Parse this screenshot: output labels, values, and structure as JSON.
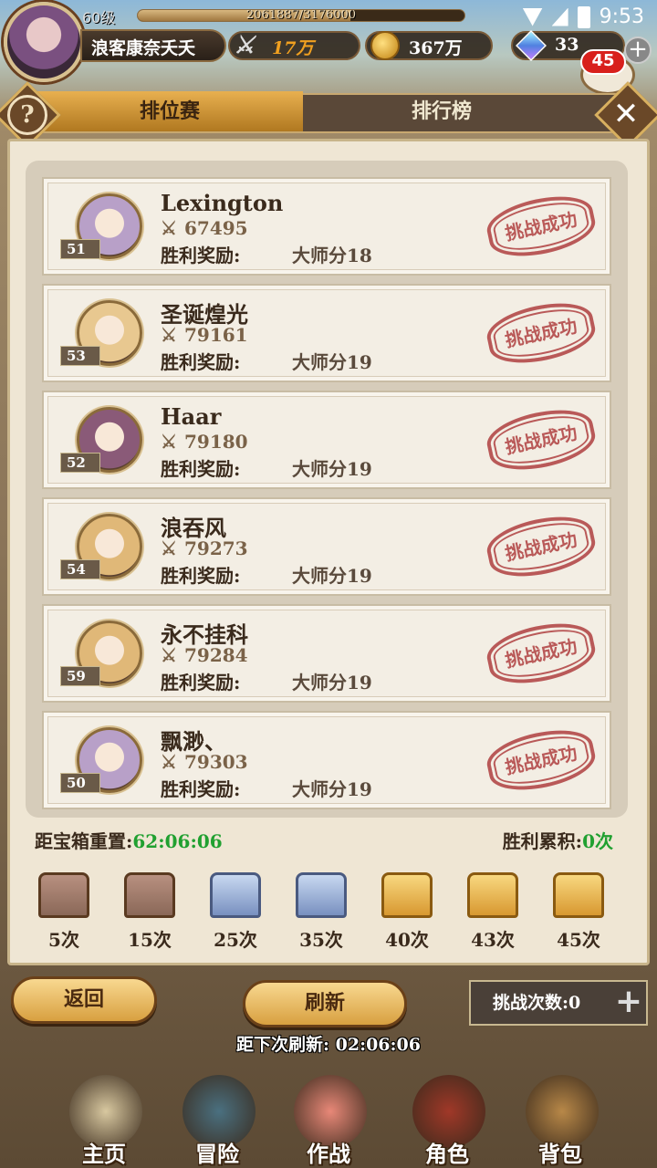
{
  "player": {
    "level": "60级",
    "exp": "2061887/3176000",
    "exp_fraction": 0.65,
    "name": "浪客康奈夭夭",
    "power": "17万",
    "gold": "367万",
    "gems": "33",
    "chat_badge": "45"
  },
  "status": {
    "time": "9:53"
  },
  "tabs": [
    {
      "label": "排位赛",
      "active": true
    },
    {
      "label": "排行榜",
      "active": false
    }
  ],
  "opponents": [
    {
      "name": "Lexington",
      "power": "67495",
      "level": "51",
      "reward_label": "胜利奖励:",
      "reward": "大师分18",
      "stamp": "挑战成功",
      "avatar_color": "#b8a0c8"
    },
    {
      "name": "圣诞煌光",
      "power": "79161",
      "level": "53",
      "reward_label": "胜利奖励:",
      "reward": "大师分19",
      "stamp": "挑战成功",
      "avatar_color": "#e8c890"
    },
    {
      "name": "Haar",
      "power": "79180",
      "level": "52",
      "reward_label": "胜利奖励:",
      "reward": "大师分19",
      "stamp": "挑战成功",
      "avatar_color": "#8a5a78"
    },
    {
      "name": "浪吞风",
      "power": "79273",
      "level": "54",
      "reward_label": "胜利奖励:",
      "reward": "大师分19",
      "stamp": "挑战成功",
      "avatar_color": "#e0b878"
    },
    {
      "name": "永不挂科",
      "power": "79284",
      "level": "59",
      "reward_label": "胜利奖励:",
      "reward": "大师分19",
      "stamp": "挑战成功",
      "avatar_color": "#e0b878"
    },
    {
      "name": "飘渺、",
      "power": "79303",
      "level": "50",
      "reward_label": "胜利奖励:",
      "reward": "大师分19",
      "stamp": "挑战成功",
      "avatar_color": "#b8a0c8"
    }
  ],
  "reset": {
    "label": "距宝箱重置:",
    "time": "62:06:06"
  },
  "wins": {
    "label": "胜利累积:",
    "value": "0次"
  },
  "chests": [
    {
      "label": "5次",
      "type": "wood"
    },
    {
      "label": "15次",
      "type": "wood"
    },
    {
      "label": "25次",
      "type": "silver"
    },
    {
      "label": "35次",
      "type": "silver"
    },
    {
      "label": "40次",
      "type": "gold"
    },
    {
      "label": "43次",
      "type": "gold"
    },
    {
      "label": "45次",
      "type": "gold"
    }
  ],
  "buttons": {
    "back": "返回",
    "refresh": "刷新",
    "challenges": "挑战次数:0"
  },
  "next_refresh": "距下次刷新: 02:06:06",
  "nav": [
    {
      "label": "主页"
    },
    {
      "label": "冒险"
    },
    {
      "label": "作战"
    },
    {
      "label": "角色"
    },
    {
      "label": "背包"
    }
  ],
  "colors": {
    "accent": "#d8a040",
    "timer_green": "#20a030",
    "stamp_red": "#b04040"
  }
}
